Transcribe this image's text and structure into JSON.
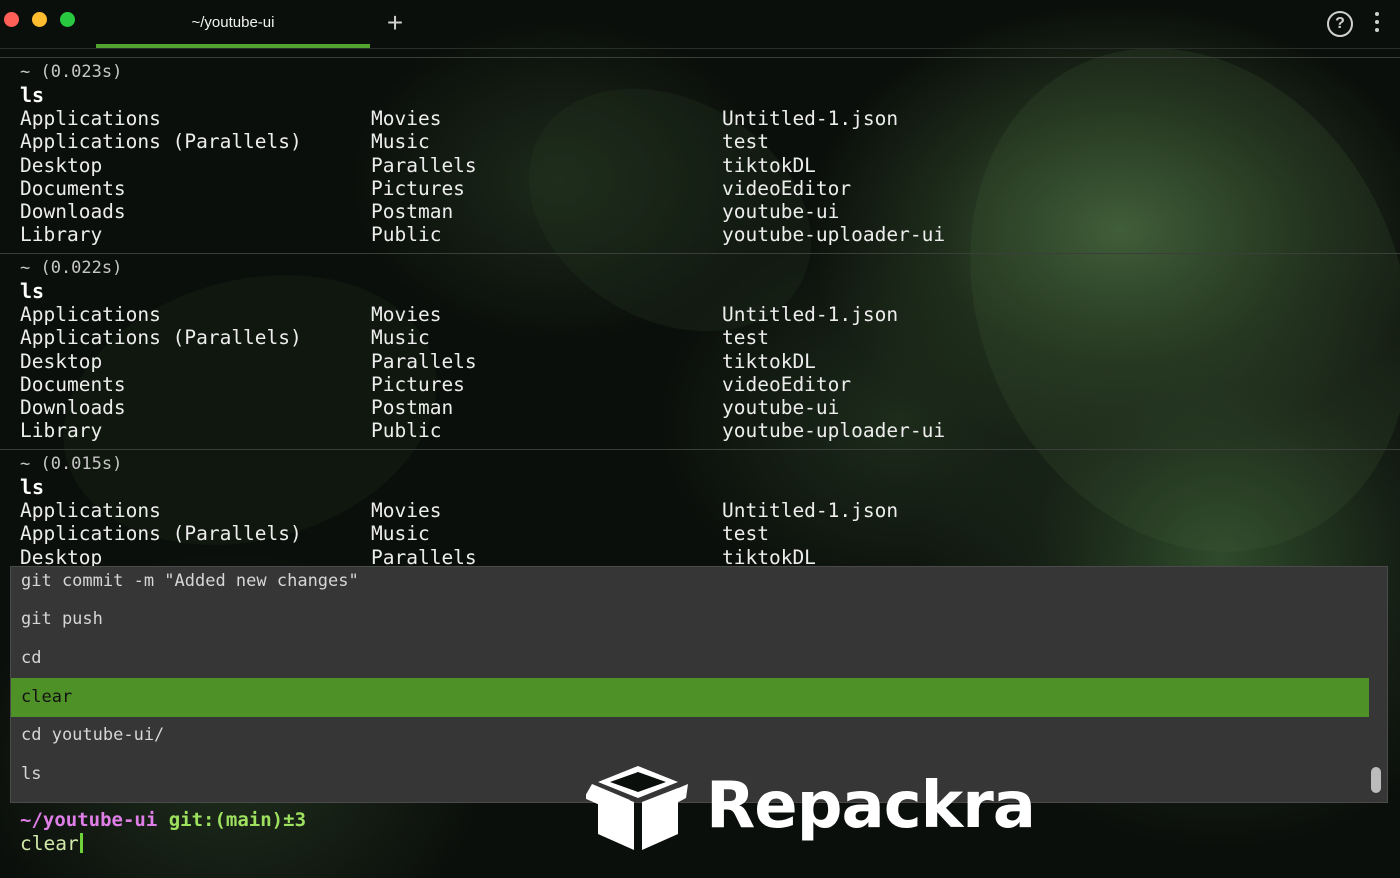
{
  "window": {
    "tab_title": "~/youtube-ui",
    "new_tab_symbol": "+",
    "help_symbol": "?"
  },
  "blocks": [
    {
      "meta": "~ (0.023s)",
      "command": "ls",
      "rows": [
        [
          "Applications",
          "Movies",
          "Untitled-1.json"
        ],
        [
          "Applications (Parallels)",
          "Music",
          "test"
        ],
        [
          "Desktop",
          "Parallels",
          "tiktokDL"
        ],
        [
          "Documents",
          "Pictures",
          "videoEditor"
        ],
        [
          "Downloads",
          "Postman",
          "youtube-ui"
        ],
        [
          "Library",
          "Public",
          "youtube-uploader-ui"
        ]
      ]
    },
    {
      "meta": "~ (0.022s)",
      "command": "ls",
      "rows": [
        [
          "Applications",
          "Movies",
          "Untitled-1.json"
        ],
        [
          "Applications (Parallels)",
          "Music",
          "test"
        ],
        [
          "Desktop",
          "Parallels",
          "tiktokDL"
        ],
        [
          "Documents",
          "Pictures",
          "videoEditor"
        ],
        [
          "Downloads",
          "Postman",
          "youtube-ui"
        ],
        [
          "Library",
          "Public",
          "youtube-uploader-ui"
        ]
      ]
    },
    {
      "meta": "~ (0.015s)",
      "command": "ls",
      "rows": [
        [
          "Applications",
          "Movies",
          "Untitled-1.json"
        ],
        [
          "Applications (Parallels)",
          "Music",
          "test"
        ],
        [
          "Desktop",
          "Parallels",
          "tiktokDL"
        ]
      ]
    }
  ],
  "history_menu": {
    "items": [
      "git commit -m \"Added new changes\"",
      "git push",
      "cd",
      "clear",
      "cd youtube-ui/",
      "ls"
    ],
    "selected": "clear"
  },
  "prompt": {
    "path": "~/youtube-ui",
    "git": "git:(main)±3",
    "input": "clear"
  },
  "watermark": {
    "text": "Repackra"
  },
  "colors": {
    "accent_green": "#52a32f",
    "selected_row": "#4e9127",
    "prompt_path": "#e07ee8",
    "prompt_git": "#9ee15f"
  }
}
